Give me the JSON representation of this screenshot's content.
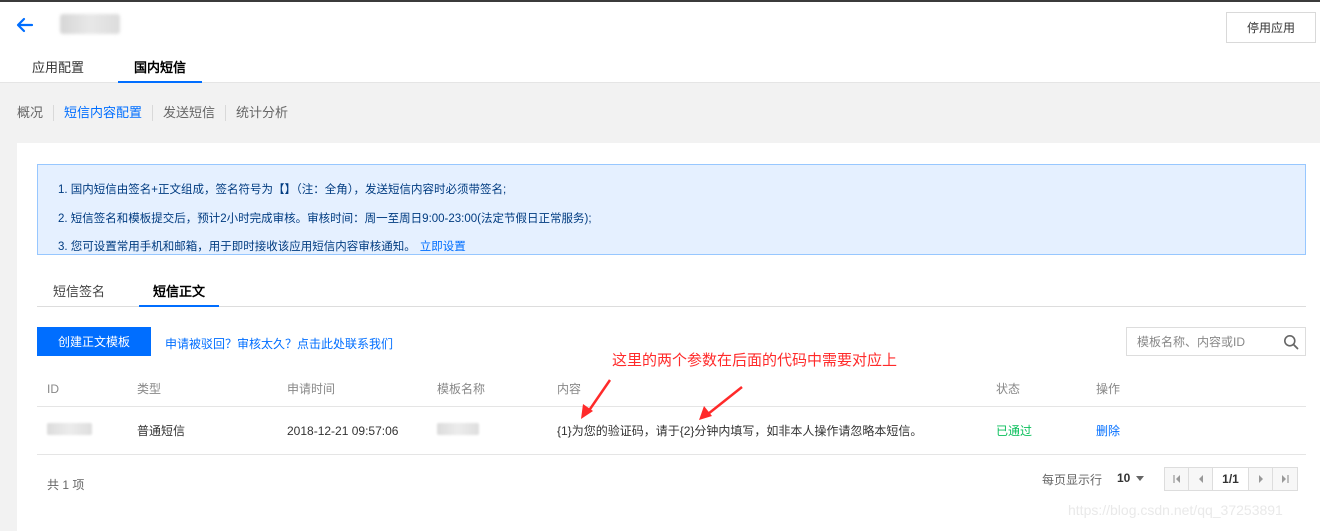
{
  "header": {
    "disable_label": "停用应用",
    "tabs": [
      {
        "label": "应用配置"
      },
      {
        "label": "国内短信"
      }
    ]
  },
  "subnav": {
    "items": [
      {
        "label": "概况"
      },
      {
        "label": "短信内容配置"
      },
      {
        "label": "发送短信"
      },
      {
        "label": "统计分析"
      }
    ]
  },
  "notice": {
    "lines": [
      "1. 国内短信由签名+正文组成，签名符号为【】（注：全角），发送短信内容时必须带签名;",
      "2. 短信签名和模板提交后，预计2小时完成审核。审核时间：周一至周日9:00-23:00(法定节假日正常服务);",
      "3. 您可设置常用手机和邮箱，用于即时接收该应用短信内容审核通知。"
    ],
    "link": "立即设置"
  },
  "body_tabs": [
    {
      "label": "短信签名"
    },
    {
      "label": "短信正文"
    }
  ],
  "toolbar": {
    "create_label": "创建正文模板",
    "contact_link": "申请被驳回？审核太久？点击此处联系我们",
    "search_placeholder": "模板名称、内容或ID"
  },
  "annotation": "这里的两个参数在后面的代码中需要对应上",
  "table": {
    "headers": [
      "ID",
      "类型",
      "申请时间",
      "模板名称",
      "内容",
      "状态",
      "操作"
    ],
    "rows": [
      {
        "type": "普通短信",
        "time": "2018-12-21 09:57:06",
        "content": "{1}为您的验证码，请于{2}分钟内填写，如非本人操作请忽略本短信。",
        "status": "已通过",
        "action": "删除"
      }
    ]
  },
  "footer": {
    "total": "共 1 项",
    "per_page_label": "每页显示行",
    "per_page_value": "10",
    "page": "1/1"
  },
  "watermark": "https://blog.csdn.net/qq_37253891",
  "colors": {
    "accent": "#006eff",
    "success": "#0abf5b",
    "annotation": "#ff2a2a",
    "notice_bg": "#e5f0ff"
  }
}
